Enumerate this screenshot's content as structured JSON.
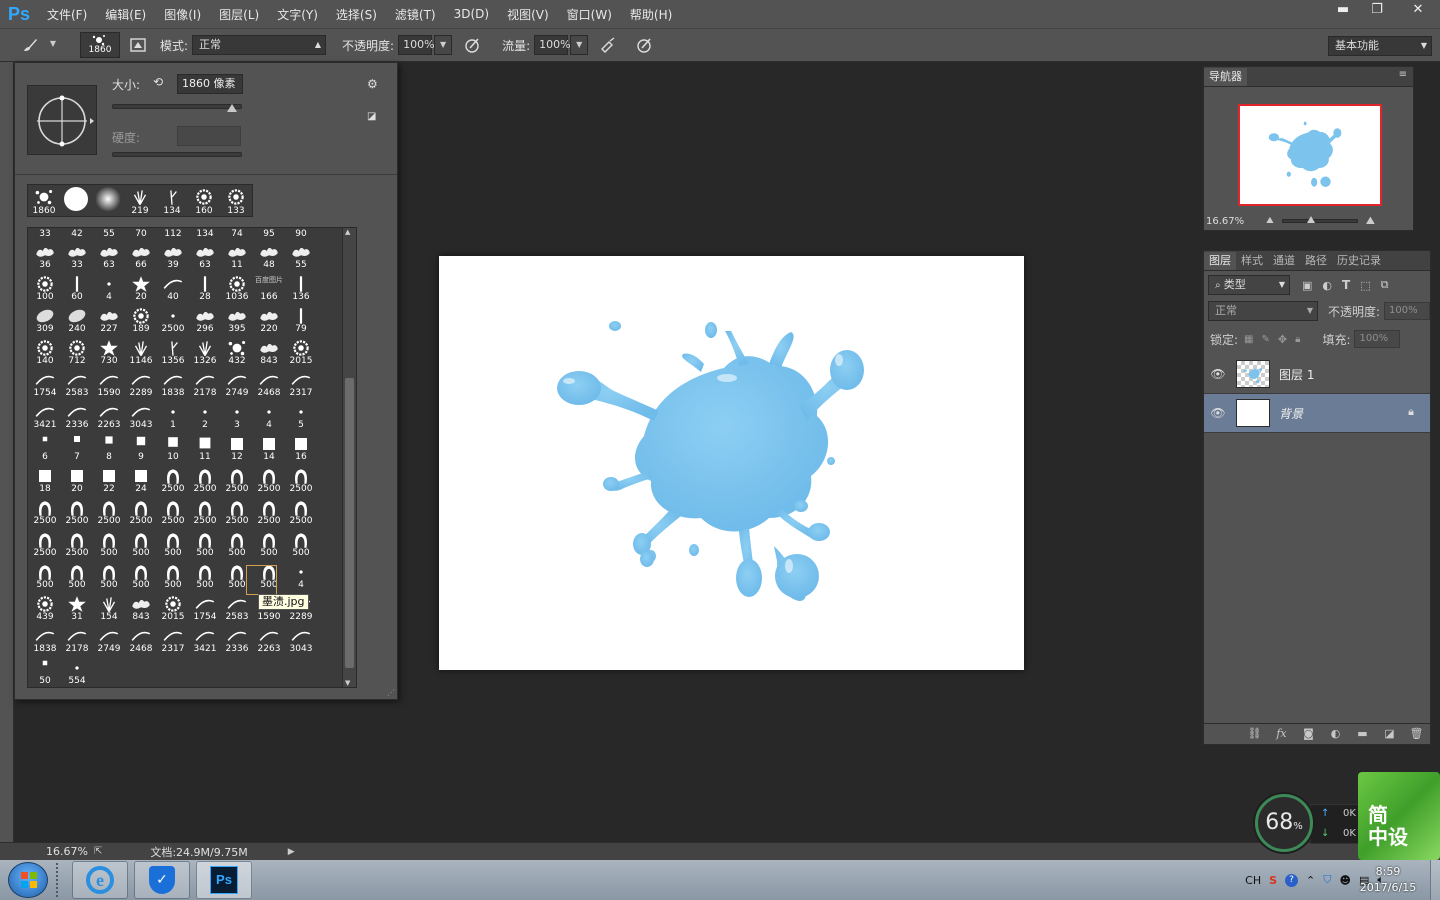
{
  "app": {
    "logo": "Ps"
  },
  "menu": [
    "文件(F)",
    "编辑(E)",
    "图像(I)",
    "图层(L)",
    "文字(Y)",
    "选择(S)",
    "滤镜(T)",
    "3D(D)",
    "视图(V)",
    "窗口(W)",
    "帮助(H)"
  ],
  "window_controls": {
    "minimize": "▬",
    "restore": "❐",
    "close": "✕"
  },
  "options": {
    "brush_size": "1860",
    "mode_label": "模式:",
    "mode_value": "正常",
    "opacity_label": "不透明度:",
    "opacity_value": "100%",
    "flow_label": "流量:",
    "flow_value": "100%",
    "workspace": "基本功能"
  },
  "brush_panel": {
    "size_label": "大小:",
    "size_value": "1860 像素",
    "hardness_label": "硬度:",
    "size_slider_fraction": 0.92,
    "recent": [
      {
        "num": "1860",
        "shape": "splat"
      },
      {
        "num": "",
        "shape": "hard"
      },
      {
        "num": "",
        "shape": "soft"
      },
      {
        "num": "219",
        "shape": "grass"
      },
      {
        "num": "134",
        "shape": "stalk"
      },
      {
        "num": "160",
        "shape": "flower"
      },
      {
        "num": "133",
        "shape": "flower"
      }
    ],
    "header_row": [
      "33",
      "42",
      "55",
      "70",
      "112",
      "134",
      "74",
      "95",
      "90"
    ],
    "rows": [
      [
        "36",
        "33",
        "63",
        "66",
        "39",
        "63",
        "11",
        "48",
        "55"
      ],
      [
        "100",
        "60",
        "4",
        "20",
        "40",
        "28",
        "1036",
        "166",
        "136"
      ],
      [
        "309",
        "240",
        "227",
        "189",
        "2500",
        "296",
        "395",
        "220",
        "79"
      ],
      [
        "140",
        "712",
        "730",
        "1146",
        "1356",
        "1326",
        "432",
        "843",
        "2015"
      ],
      [
        "1754",
        "2583",
        "1590",
        "2289",
        "1838",
        "2178",
        "2749",
        "2468",
        "2317"
      ],
      [
        "3421",
        "2336",
        "2263",
        "3043",
        "1",
        "2",
        "3",
        "4",
        "5"
      ],
      [
        "6",
        "7",
        "8",
        "9",
        "10",
        "11",
        "12",
        "14",
        "16"
      ],
      [
        "18",
        "20",
        "22",
        "24",
        "2500",
        "2500",
        "2500",
        "2500",
        "2500"
      ],
      [
        "2500",
        "2500",
        "2500",
        "2500",
        "2500",
        "2500",
        "2500",
        "2500",
        "2500"
      ],
      [
        "2500",
        "2500",
        "500",
        "500",
        "500",
        "500",
        "500",
        "500",
        "500"
      ],
      [
        "500",
        "500",
        "500",
        "500",
        "500",
        "500",
        "500",
        "500",
        "4"
      ],
      [
        "439",
        "31",
        "154",
        "843",
        "2015",
        "1754",
        "2583",
        "1590",
        "2289"
      ],
      [
        "1838",
        "2178",
        "2749",
        "2468",
        "2317",
        "3421",
        "2336",
        "2263",
        "3043"
      ],
      [
        "50",
        "554"
      ]
    ],
    "baidu_label": "百度图片",
    "tooltip": "墨渍.jpg"
  },
  "status": {
    "zoom": "16.67%",
    "doc": "文档:24.9M/9.75M"
  },
  "navigator": {
    "tab": "导航器",
    "zoom": "16.67%"
  },
  "layers_panel": {
    "tabs": [
      "图层",
      "样式",
      "通道",
      "路径",
      "历史记录"
    ],
    "filter_label": "类型",
    "blend_mode": "正常",
    "opacity_label": "不透明度:",
    "opacity_value": "100%",
    "lock_label": "锁定:",
    "fill_label": "填充:",
    "fill_value": "100%",
    "layers": [
      {
        "name": "图层 1",
        "selected": false,
        "locked": false
      },
      {
        "name": "背景",
        "selected": true,
        "locked": true
      }
    ]
  },
  "widgets": {
    "speed_value": "68",
    "speed_unit": "%",
    "up": "0K",
    "down": "0K",
    "tile_line1": "简",
    "tile_line2": "中设"
  },
  "taskbar": {
    "tray": [
      "CH",
      "S",
      "?"
    ],
    "time": "8:59",
    "date": "2017/6/15"
  },
  "colors": {
    "accent": "#31a8ff",
    "splat": "#7cc4ee",
    "nav_frame": "#e0262b",
    "selected_layer": "#6b7d96"
  }
}
